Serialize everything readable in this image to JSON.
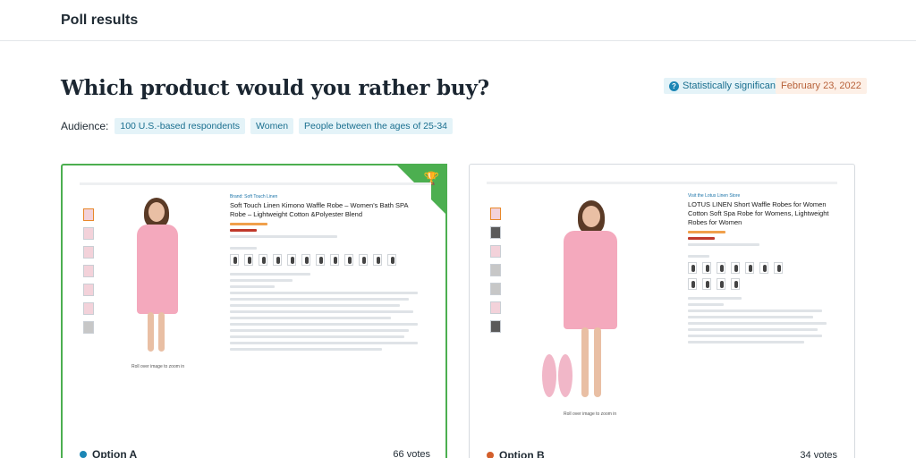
{
  "header": {
    "title": "Poll results"
  },
  "question": "Which product would you rather buy?",
  "badges": {
    "significance": "Statistically significant",
    "date": "February 23, 2022"
  },
  "audience": {
    "label": "Audience:",
    "chips": [
      "100 U.S.-based respondents",
      "Women",
      "People between the ages of 25-34"
    ]
  },
  "options": [
    {
      "label": "Option A",
      "votes": "66 votes",
      "color": "#1c86b5",
      "winner": true,
      "product": {
        "brand": "Brand: Soft Touch Linen",
        "title": "Soft Touch Linen Kimono Waffle Robe – Women's Bath SPA Robe – Lightweight Cotton &Polyester Blend",
        "zoom_note": "Roll over image to zoom in"
      }
    },
    {
      "label": "Option B",
      "votes": "34 votes",
      "color": "#d35f2c",
      "winner": false,
      "product": {
        "brand": "Visit the Lotus Linen Store",
        "title": "LOTUS LINEN Short Waffle Robes for Women Cotton Soft Spa Robe for Womens, Lightweight Robes for Women",
        "zoom_note": "Roll over image to zoom in"
      }
    }
  ],
  "icons": {
    "winner": "trophy-icon",
    "help": "question-circle-icon"
  }
}
